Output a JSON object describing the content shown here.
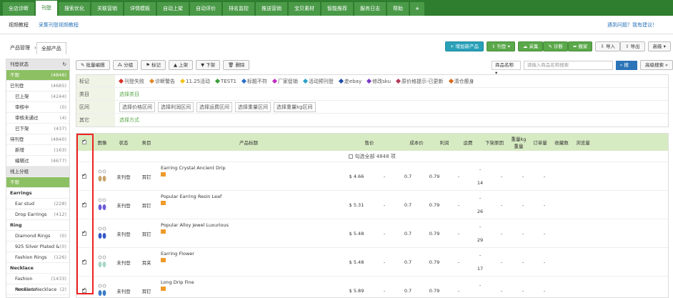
{
  "topnav": {
    "tabs": [
      "全店诊断",
      "刊登",
      "搜索优化",
      "关联营销",
      "详情模板",
      "自动上架",
      "自动评价",
      "排名监控",
      "推送营销",
      "宝贝素材",
      "智能推荐",
      "服务日志",
      "帮助"
    ],
    "active_index": 1
  },
  "subbar": {
    "left": "视频教程",
    "link": "采集刊登视频教程",
    "right": "遇到问题？我有建议！"
  },
  "breadcrumb": {
    "root": "产品管理",
    "current": "全部产品"
  },
  "toolbar": {
    "add": "增加新产品",
    "publish": "刊登",
    "collect": "采集",
    "diagnose": "诊断",
    "move": "搬家",
    "import": "导入",
    "export": "导出",
    "advanced": "高级"
  },
  "table_toolbar": [
    "批量编辑",
    "分组",
    "标记",
    "上架",
    "下架",
    "删除"
  ],
  "search": {
    "field": "商品名称",
    "placeholder": "请输入商品名称搜索",
    "button": "搜索",
    "advanced": "高级搜索"
  },
  "sidebar": {
    "header": "刊登状态",
    "rows": [
      {
        "label": "不限",
        "count": "(4846)",
        "type": "sel"
      },
      {
        "label": "已刊登",
        "count": "(4685)",
        "type": ""
      },
      {
        "label": "已上架",
        "count": "(4244)",
        "type": "ind"
      },
      {
        "label": "审核中",
        "count": "(0)",
        "type": "ind"
      },
      {
        "label": "审核未通过",
        "count": "(4)",
        "type": "ind"
      },
      {
        "label": "已下架",
        "count": "(437)",
        "type": "ind"
      },
      {
        "label": "待刊登",
        "count": "(4840)",
        "type": ""
      },
      {
        "label": "新增",
        "count": "(163)",
        "type": "ind"
      },
      {
        "label": "编辑过",
        "count": "(4677)",
        "type": "ind"
      },
      {
        "label": "线上分组",
        "count": "",
        "type": "hd"
      },
      {
        "label": "不限",
        "count": "",
        "type": "sel"
      },
      {
        "label": "Earrings",
        "count": "",
        "type": "bold"
      },
      {
        "label": "Ear stud",
        "count": "(228)",
        "type": "ind"
      },
      {
        "label": "Drop Earrings",
        "count": "(412)",
        "type": "ind"
      },
      {
        "label": "Ring",
        "count": "",
        "type": "bold"
      },
      {
        "label": "Diamond Rings",
        "count": "(0)",
        "type": "ind"
      },
      {
        "label": "925 Silver Plated &",
        "count": "(0)",
        "type": "ind"
      },
      {
        "label": "Fashion Rings",
        "count": "(126)",
        "type": "ind"
      },
      {
        "label": "Necklace",
        "count": "",
        "type": "bold"
      },
      {
        "label": "Fashion Necklace",
        "count": "(1433)",
        "type": "ind"
      },
      {
        "label": "Pendant Necklace",
        "count": "(2)",
        "type": "ind"
      }
    ]
  },
  "filters": {
    "tag_label": "标记",
    "tags": [
      {
        "t": "刊登失败",
        "c": "#d9312b"
      },
      {
        "t": "诊断警告",
        "c": "#e0892a"
      },
      {
        "t": "11.25活动",
        "c": "#f2c21a"
      },
      {
        "t": "TEST1",
        "c": "#3aa03a"
      },
      {
        "t": "标题不符",
        "c": "#2a6fc9"
      },
      {
        "t": "厂家促销",
        "c": "#c12dc1"
      },
      {
        "t": "活动预刊登",
        "c": "#2aa0c9"
      },
      {
        "t": "走ebay",
        "c": "#1d4fa8"
      },
      {
        "t": "修改sku",
        "c": "#7a3ac9"
      },
      {
        "t": "原价格提示-已更新",
        "c": "#b5385a"
      },
      {
        "t": "清仓瘦身",
        "c": "#d86a1a"
      }
    ],
    "cat_label": "类目",
    "cat_value": "选择类目",
    "range_label": "区间",
    "ranges": [
      "选择价格区间",
      "选择利润区间",
      "选择运费区间",
      "选择重量区间",
      "选择重量kg区间"
    ],
    "other_label": "其它",
    "other_value": "选择方式"
  },
  "table": {
    "headers": [
      "图像",
      "状态",
      "类目",
      "产品标题",
      "售价",
      "成本价",
      "利润",
      "运费",
      "下架原因",
      "重量kg",
      "订单量",
      "收藏数",
      "浏览量"
    ],
    "weight_sub": "重量",
    "select_all": "勾选全部 4848 项",
    "rows": [
      {
        "status": "未刊登",
        "cat": "耳钉",
        "title": "Earring Crystal Ancient Drip",
        "price": "$ 4.66",
        "cost": "-",
        "profit": "0.7",
        "ship": "0.79",
        "reason": "-",
        "kg": "-",
        "weight": "14",
        "orders": "-",
        "fav": "-",
        "views": "-",
        "color": "#c9a36a"
      },
      {
        "status": "未刊登",
        "cat": "耳钉",
        "title": "Popular Earring Resin Leaf",
        "price": "$ 5.31",
        "cost": "-",
        "profit": "0.7",
        "ship": "0.79",
        "reason": "-",
        "kg": "-",
        "weight": "26",
        "orders": "-",
        "fav": "-",
        "views": "-",
        "color": "#6b5bd6"
      },
      {
        "status": "未刊登",
        "cat": "耳钉",
        "title": "Popular Alloy Jewel Luxurious",
        "price": "$ 5.48",
        "cost": "-",
        "profit": "0.7",
        "ship": "0.79",
        "reason": "-",
        "kg": "-",
        "weight": "29",
        "orders": "-",
        "fav": "-",
        "views": "-",
        "color": "#3558c9"
      },
      {
        "status": "未刊登",
        "cat": "耳夹",
        "title": "Earring Flower",
        "price": "$ 5.48",
        "cost": "-",
        "profit": "0.7",
        "ship": "0.79",
        "reason": "-",
        "kg": "-",
        "weight": "17",
        "orders": "-",
        "fav": "-",
        "views": "-",
        "color": "#a8d6c8"
      },
      {
        "status": "未刊登",
        "cat": "耳钉",
        "title": "Long Drip Fine",
        "price": "$ 5.89",
        "cost": "-",
        "profit": "0.7",
        "ship": "0.79",
        "reason": "-",
        "kg": "-",
        "weight": "",
        "orders": "-",
        "fav": "-",
        "views": "-",
        "color": "#3a7bc8"
      }
    ]
  }
}
